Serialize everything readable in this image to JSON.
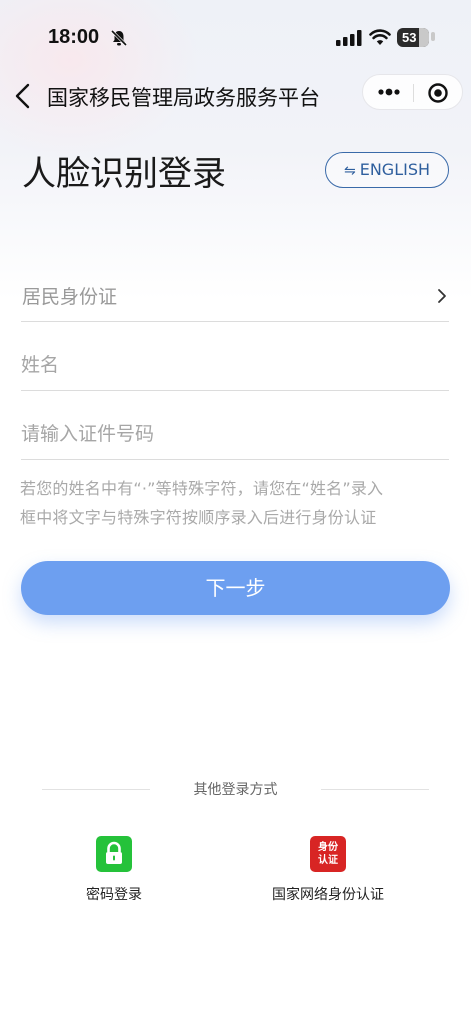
{
  "status_bar": {
    "time": "18:00",
    "battery_level": "53"
  },
  "nav": {
    "title": "国家移民管理局政务服务平台"
  },
  "page": {
    "title": "人脸识别登录",
    "language_button": "ENGLISH"
  },
  "form": {
    "id_type": {
      "value": "居民身份证"
    },
    "name": {
      "placeholder": "姓名"
    },
    "id_number": {
      "placeholder": "请输入证件号码"
    },
    "hint_line1": "若您的姓名中有“·”等特殊字符，请您在“姓名”录入",
    "hint_line2": "框中将文字与特殊字符按顺序录入后进行身份认证",
    "next_button": "下一步"
  },
  "other_login": {
    "title": "其他登录方式",
    "options": [
      {
        "label": "密码登录",
        "icon": "lock-icon",
        "color": "#25c23a"
      },
      {
        "label": "国家网络身份认证",
        "icon": "id-auth-icon",
        "color": "#d82524",
        "icon_text": "身份认证"
      }
    ]
  },
  "colors": {
    "accent": "#6d9ff0",
    "language_border": "#3a6aa9"
  }
}
